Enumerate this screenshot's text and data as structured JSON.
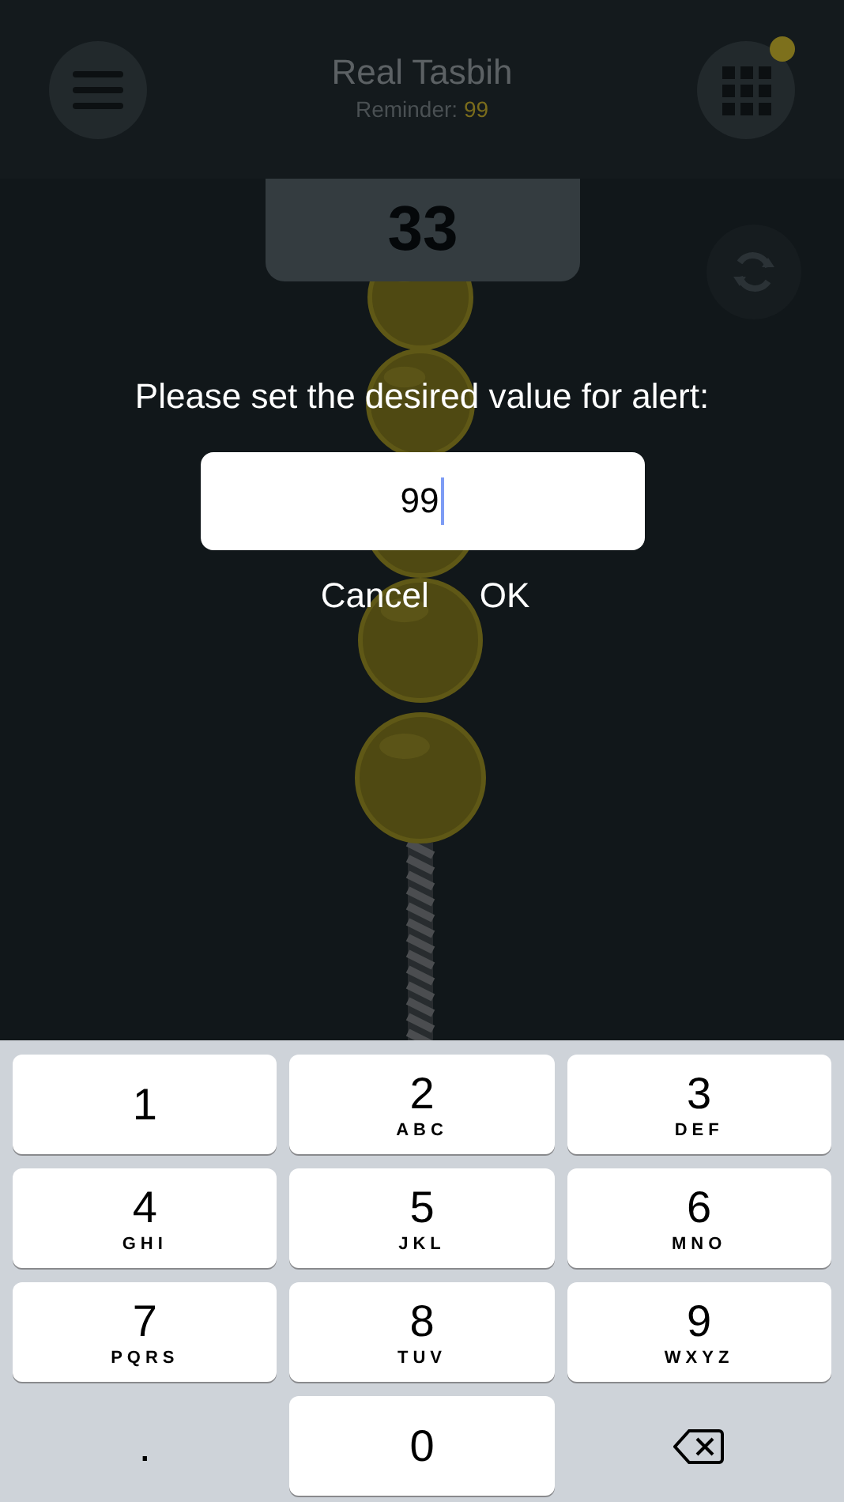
{
  "header": {
    "title": "Real Tasbih",
    "reminder_label": "Reminder:",
    "reminder_value": "99",
    "notification_dot": true
  },
  "counter": "33",
  "dialog": {
    "message": "Please set the desired value for alert:",
    "input_value": "99",
    "buttons": [
      "Cancel",
      "OK"
    ]
  },
  "keypad": {
    "keys": [
      {
        "kind": "digit",
        "digit": "1"
      },
      {
        "kind": "digit",
        "digit": "2",
        "letters": "ABC"
      },
      {
        "kind": "digit",
        "digit": "3",
        "letters": "DEF"
      },
      {
        "kind": "digit",
        "digit": "4",
        "letters": "GHI"
      },
      {
        "kind": "digit",
        "digit": "5",
        "letters": "JKL"
      },
      {
        "kind": "digit",
        "digit": "6",
        "letters": "MNO"
      },
      {
        "kind": "digit",
        "digit": "7",
        "letters": "PQRS"
      },
      {
        "kind": "digit",
        "digit": "8",
        "letters": "TUV"
      },
      {
        "kind": "digit",
        "digit": "9",
        "letters": "WXYZ"
      },
      {
        "kind": "symbol",
        "digit": "."
      },
      {
        "kind": "digit",
        "digit": "0"
      },
      {
        "kind": "delete"
      }
    ]
  }
}
